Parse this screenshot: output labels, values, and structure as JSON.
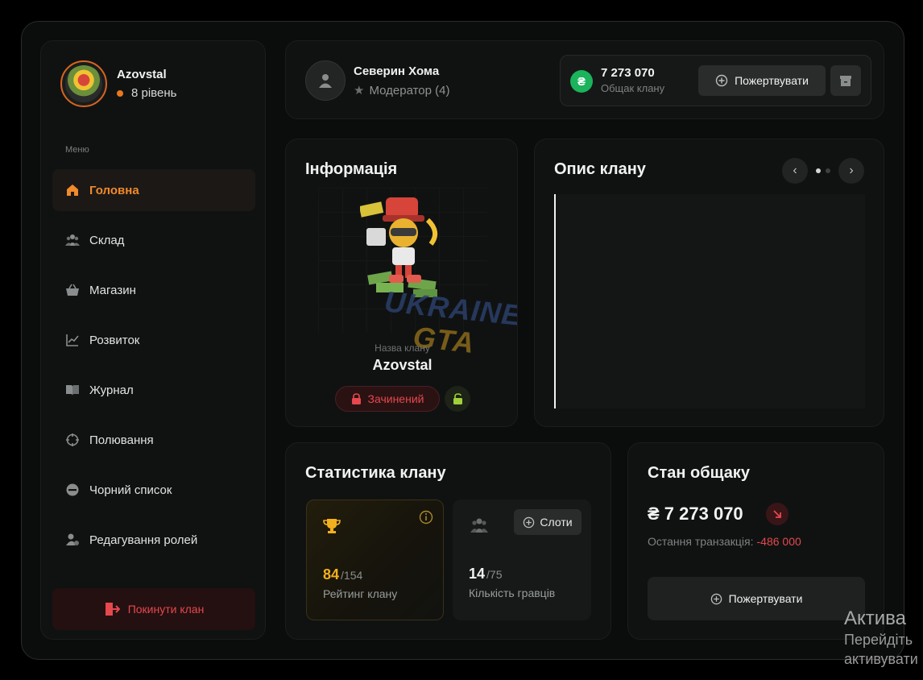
{
  "profile": {
    "clan_name": "Azovstal",
    "level": "8 рівень"
  },
  "menu": {
    "title": "Меню",
    "items": [
      {
        "label": "Головна",
        "icon": "home-icon",
        "active": true
      },
      {
        "label": "Склад",
        "icon": "people-icon",
        "active": false
      },
      {
        "label": "Магазин",
        "icon": "basket-icon",
        "active": false
      },
      {
        "label": "Розвиток",
        "icon": "chart-icon",
        "active": false
      },
      {
        "label": "Журнал",
        "icon": "book-icon",
        "active": false
      },
      {
        "label": "Полювання",
        "icon": "crosshair-icon",
        "active": false
      },
      {
        "label": "Чорний список",
        "icon": "block-icon",
        "active": false
      },
      {
        "label": "Редагування ролей",
        "icon": "user-settings-icon",
        "active": false
      }
    ],
    "leave_label": "Покинути клан"
  },
  "topbar": {
    "user_name": "Северин Хома",
    "user_role": "Модератор (4)",
    "fund_amount": "7 273 070",
    "fund_label": "Общак клану",
    "donate_label": "Пожертвувати",
    "currency_symbol": "₴"
  },
  "info": {
    "title": "Інформація",
    "clan_label": "Назва клану",
    "clan_name": "Azovstal",
    "status_label": "Зачинений",
    "watermark_line1": "UKRAINE",
    "watermark_line2": "GTA"
  },
  "description": {
    "title": "Опис клану"
  },
  "stats": {
    "title": "Статистика клану",
    "rating_value": "84",
    "rating_total": "/154",
    "rating_caption": "Рейтинг клану",
    "players_value": "14",
    "players_total": "/75",
    "players_caption": "Кількість гравців",
    "slots_label": "Слоти"
  },
  "fund": {
    "title": "Стан общаку",
    "amount": "₴ 7 273 070",
    "last_tx_label": "Остання транзакція:",
    "last_tx_value": "-486 000",
    "donate_label": "Пожертвувати"
  },
  "activation": {
    "line1": "Актива",
    "line2": "Перейдіть",
    "line3": "активувати"
  },
  "colors": {
    "accent": "#f08a2a",
    "danger": "#e5484d",
    "coin": "#1bb35b",
    "gold": "#f2b01e"
  }
}
